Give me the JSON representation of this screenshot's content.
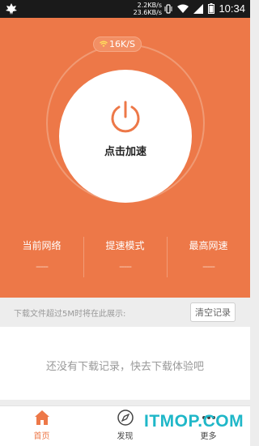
{
  "status_bar": {
    "speed_up": "2.2KB/s",
    "speed_down": "23.6KB/s",
    "time": "10:34",
    "icons": [
      "leaf-icon",
      "vibrate-icon",
      "wifi-icon",
      "signal-icon",
      "battery-icon"
    ]
  },
  "hero": {
    "speed_badge": "16K/S",
    "circle_label": "点击加速",
    "stats": [
      {
        "label": "当前网络",
        "value": "-----"
      },
      {
        "label": "提速模式",
        "value": "-----"
      },
      {
        "label": "最高网速",
        "value": "-----"
      }
    ]
  },
  "downloads": {
    "hint": "下载文件超过5M时将在此展示:",
    "clear_label": "清空记录",
    "empty_text": "还没有下载记录，快去下载体验吧"
  },
  "tabbar": {
    "tabs": [
      {
        "label": "首页",
        "icon": "home-icon",
        "active": true
      },
      {
        "label": "发现",
        "icon": "compass-icon",
        "active": false
      },
      {
        "label": "更多",
        "icon": "more-icon",
        "active": false
      }
    ]
  },
  "watermark": "ITMOP.COM",
  "colors": {
    "accent": "#ed7848",
    "watermark": "#1fb7c8"
  }
}
